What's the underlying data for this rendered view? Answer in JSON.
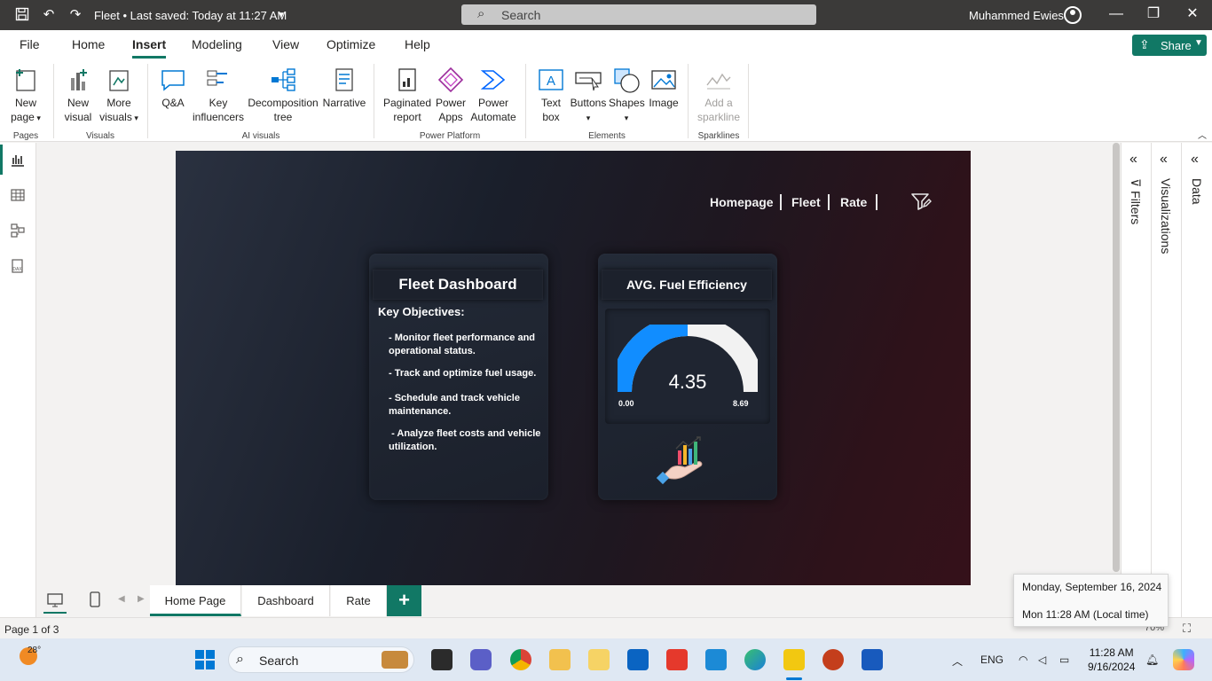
{
  "titlebar": {
    "title": "Fleet • Last saved: Today at 11:27 AM",
    "search_placeholder": "Search",
    "user": "Muhammed Ewies"
  },
  "menu": {
    "items": [
      "File",
      "Home",
      "Insert",
      "Modeling",
      "View",
      "Optimize",
      "Help"
    ],
    "active": "Insert",
    "share": "Share"
  },
  "ribbon": {
    "new_page": "New page",
    "new_visual": "New visual",
    "more_visuals": "More visuals",
    "qa": "Q&A",
    "key_influencers": "Key influencers",
    "decomposition_tree": "Decomposition tree",
    "narrative": "Narrative",
    "paginated_report": "Paginated report",
    "power_apps": "Power Apps",
    "power_automate": "Power Automate",
    "text_box": "Text box",
    "buttons": "Buttons",
    "shapes": "Shapes",
    "image": "Image",
    "add_sparkline": "Add a sparkline",
    "groups": {
      "pages": "Pages",
      "visuals": "Visuals",
      "ai_visuals": "AI visuals",
      "power_platform": "Power Platform",
      "elements": "Elements",
      "sparklines": "Sparklines"
    }
  },
  "report": {
    "nav": [
      "Homepage",
      "Fleet",
      "Rate"
    ],
    "dashboard_card": {
      "title": "Fleet Dashboard",
      "objectives_heading": "Key Objectives:",
      "objectives": [
        "- Monitor fleet performance and operational status.",
        "- Track and optimize fuel usage.",
        "- Schedule and track vehicle maintenance.",
        " - Analyze fleet costs and vehicle utilization."
      ]
    },
    "gauge_card": {
      "title": "AVG. Fuel Efficiency",
      "value": "4.35",
      "min": "0.00",
      "max": "8.69",
      "fill_fraction": 0.5,
      "fill_color": "#118dff",
      "track_color": "#f2f2f2"
    }
  },
  "panes": {
    "filters": "Filters",
    "visualizations": "Visualizations",
    "data": "Data"
  },
  "pages": {
    "tabs": [
      "Home Page",
      "Dashboard",
      "Rate"
    ],
    "active": "Home Page",
    "add": "+"
  },
  "status": {
    "page": "Page 1 of 3",
    "zoom": "70%"
  },
  "tooltip": {
    "date": "Monday, September 16, 2024",
    "time": "Mon 11:28 AM (Local time)"
  },
  "taskbar": {
    "temperature": "28°",
    "search_placeholder": "Search",
    "language": "ENG",
    "time": "11:28 AM",
    "date": "9/16/2024"
  },
  "colors": {
    "accent": "#117865",
    "titlebar": "#3b3a39"
  }
}
